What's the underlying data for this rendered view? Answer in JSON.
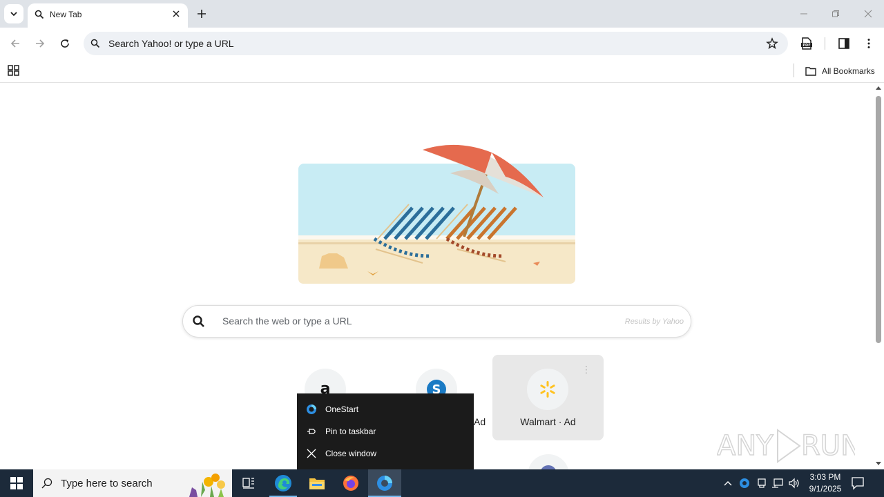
{
  "browser": {
    "tab": {
      "title": "New Tab"
    },
    "omnibox": {
      "placeholder": "Search Yahoo! or type a URL"
    },
    "bookmarks_bar": {
      "all_bookmarks": "All Bookmarks"
    }
  },
  "newtab": {
    "search": {
      "placeholder": "Search the web or type a URL",
      "attribution": "Results by Yahoo"
    },
    "tiles": [
      {
        "icon": "amazon-icon",
        "label": ""
      },
      {
        "icon": "shopping-icon",
        "label": ""
      },
      {
        "icon": "walmart-icon",
        "label": "Walmart · Ad"
      }
    ],
    "partial_ad_label": "Ad",
    "watermark": "ANY RUN"
  },
  "jumplist": {
    "items": [
      {
        "icon": "onestart-icon",
        "label": "OneStart"
      },
      {
        "icon": "pin-icon",
        "label": "Pin to taskbar"
      },
      {
        "icon": "close-icon",
        "label": "Close window"
      }
    ]
  },
  "taskbar": {
    "search_placeholder": "Type here to search",
    "clock": {
      "time": "3:03 PM",
      "date": "9/1/2025"
    }
  },
  "colors": {
    "tabbar": "#dfe3e8",
    "omnibox": "#eef1f5",
    "taskbar": "#1c2a3a",
    "walmart_yellow": "#ffc220"
  }
}
